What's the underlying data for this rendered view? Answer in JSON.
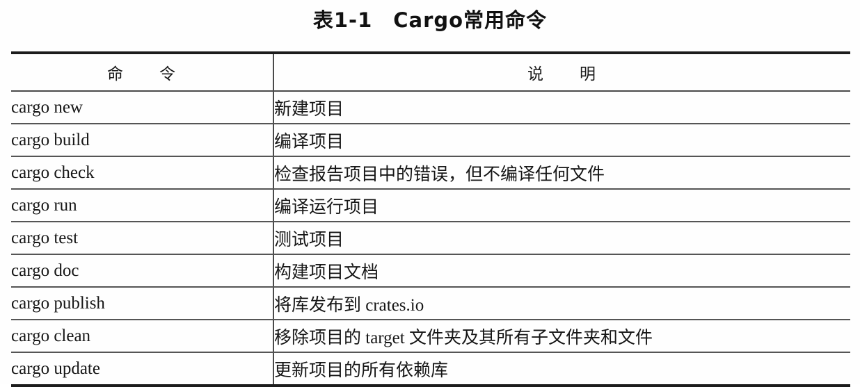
{
  "caption": "表1-1　Cargo常用命令",
  "table": {
    "headers": {
      "command": "命　　令",
      "description": "说　　明"
    },
    "rows": [
      {
        "command": "cargo new",
        "description": "新建项目"
      },
      {
        "command": "cargo build",
        "description": "编译项目"
      },
      {
        "command": "cargo check",
        "description": "检查报告项目中的错误，但不编译任何文件"
      },
      {
        "command": "cargo run",
        "description": "编译运行项目"
      },
      {
        "command": "cargo test",
        "description": "测试项目"
      },
      {
        "command": "cargo doc",
        "description": "构建项目文档"
      },
      {
        "command": "cargo publish",
        "description": "将库发布到 crates.io"
      },
      {
        "command": "cargo clean",
        "description": "移除项目的 target 文件夹及其所有子文件夹和文件"
      },
      {
        "command": "cargo update",
        "description": "更新项目的所有依赖库"
      }
    ]
  },
  "colors": {
    "page_background": "#fefefe",
    "text": "#161616",
    "rule_heavy": "#1c1c1c",
    "rule_light": "#555555"
  }
}
